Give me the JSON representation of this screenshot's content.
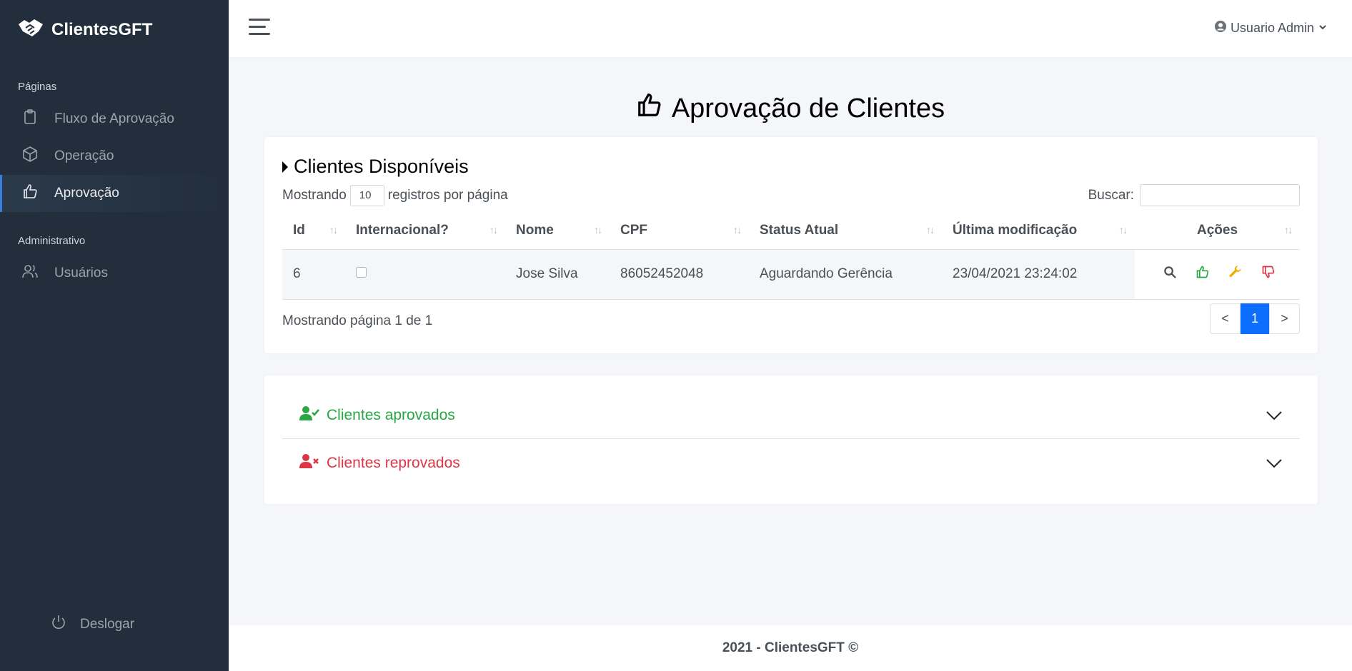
{
  "sidebar": {
    "brand": "ClientesGFT",
    "section_pages": "Páginas",
    "items": [
      {
        "label": "Fluxo de Aprovação",
        "icon": "clipboard-icon"
      },
      {
        "label": "Operação",
        "icon": "box-icon"
      },
      {
        "label": "Aprovação",
        "icon": "thumbs-up-icon",
        "active": true
      }
    ],
    "section_admin": "Administrativo",
    "admin_items": [
      {
        "label": "Usuários",
        "icon": "users-icon"
      }
    ],
    "logout": "Deslogar"
  },
  "topbar": {
    "user": "Usuario Admin"
  },
  "page": {
    "title": "Aprovação de Clientes"
  },
  "table_card": {
    "title": "Clientes Disponíveis",
    "length_prefix": "Mostrando",
    "length_value": "10",
    "length_suffix": "registros por página",
    "search_label": "Buscar:",
    "columns": [
      "Id",
      "Internacional?",
      "Nome",
      "CPF",
      "Status Atual",
      "Última modificação",
      "Ações"
    ],
    "rows": [
      {
        "id": "6",
        "internacional": false,
        "nome": "Jose Silva",
        "cpf": "86052452048",
        "status": "Aguardando Gerência",
        "modificacao": "23/04/2021 23:24:02"
      }
    ],
    "info": "Mostrando página 1 de 1",
    "pager": {
      "prev": "<",
      "current": "1",
      "next": ">"
    }
  },
  "accordion": {
    "approved": "Clientes aprovados",
    "rejected": "Clientes reprovados"
  },
  "footer": "2021 - ClientesGFT ©",
  "colors": {
    "sidebar_bg": "#222e3c",
    "primary": "#0d6efd",
    "success": "#28a745",
    "danger": "#dc3545",
    "warning": "#f0ad00"
  }
}
